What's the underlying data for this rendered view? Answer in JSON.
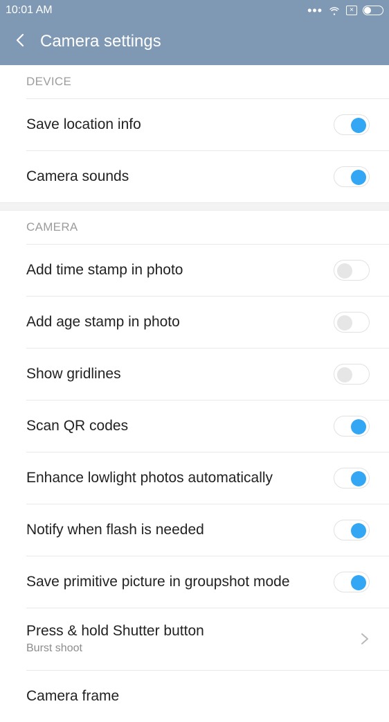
{
  "status_bar": {
    "time": "10:01 AM",
    "dots": "•••",
    "icons": [
      "wifi-icon",
      "x-box-icon",
      "battery-icon"
    ]
  },
  "header": {
    "title": "Camera  settings"
  },
  "sections": {
    "device": {
      "title": "DEVICE",
      "items": [
        {
          "label": "Save location info",
          "toggle": true
        },
        {
          "label": "Camera sounds",
          "toggle": true
        }
      ]
    },
    "camera": {
      "title": "CAMERA",
      "items": [
        {
          "label": "Add time stamp in photo",
          "toggle": false
        },
        {
          "label": "Add age stamp in photo",
          "toggle": false
        },
        {
          "label": "Show gridlines",
          "toggle": false
        },
        {
          "label": "Scan QR codes",
          "toggle": true
        },
        {
          "label": "Enhance lowlight photos automatically",
          "toggle": true
        },
        {
          "label": "Notify when flash is needed",
          "toggle": true
        },
        {
          "label": "Save primitive picture in groupshot mode",
          "toggle": true
        },
        {
          "label": "Press & hold Shutter button",
          "subtitle": "Burst shoot",
          "type": "nav"
        },
        {
          "label": "Camera frame"
        }
      ]
    }
  },
  "colors": {
    "header_bg": "#7f99b5",
    "accent": "#34a7f4"
  }
}
